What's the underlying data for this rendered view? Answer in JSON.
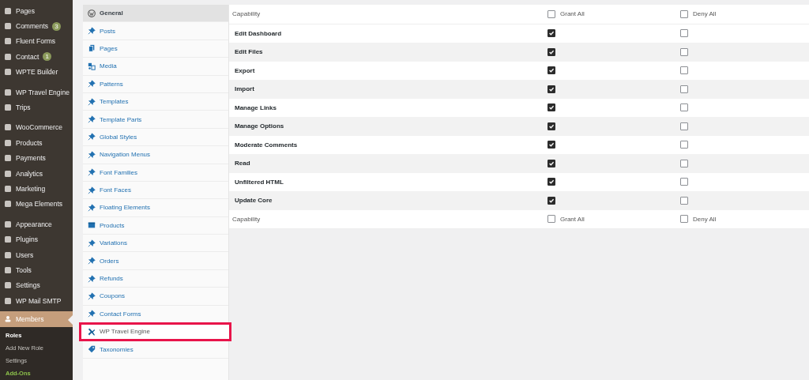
{
  "admin_menu": {
    "groups": [
      [
        {
          "label": "Pages"
        },
        {
          "label": "Comments",
          "badge": "3"
        },
        {
          "label": "Fluent Forms"
        },
        {
          "label": "Contact",
          "badge": "1"
        },
        {
          "label": "WPTE Builder"
        }
      ],
      [
        {
          "label": "WP Travel Engine"
        },
        {
          "label": "Trips"
        }
      ],
      [
        {
          "label": "WooCommerce"
        },
        {
          "label": "Products"
        },
        {
          "label": "Payments"
        },
        {
          "label": "Analytics"
        },
        {
          "label": "Marketing"
        },
        {
          "label": "Mega Elements"
        }
      ],
      [
        {
          "label": "Appearance"
        },
        {
          "label": "Plugins"
        },
        {
          "label": "Users"
        },
        {
          "label": "Tools"
        },
        {
          "label": "Settings"
        },
        {
          "label": "WP Mail SMTP"
        }
      ]
    ],
    "current": {
      "label": "Members"
    },
    "submenu": [
      {
        "label": "Roles",
        "selected": true
      },
      {
        "label": "Add New Role",
        "selected": false
      },
      {
        "label": "Settings",
        "selected": false
      },
      {
        "label": "Add-Ons",
        "selected": false,
        "color": "#8cc04b"
      }
    ]
  },
  "capability_tabs": [
    {
      "label": "General",
      "kind": "wordpress",
      "selected": true,
      "highlighted": false
    },
    {
      "label": "Posts",
      "kind": "pin",
      "selected": false,
      "highlighted": false
    },
    {
      "label": "Pages",
      "kind": "pages",
      "selected": false,
      "highlighted": false
    },
    {
      "label": "Media",
      "kind": "media",
      "selected": false,
      "highlighted": false
    },
    {
      "label": "Patterns",
      "kind": "pin",
      "selected": false,
      "highlighted": false
    },
    {
      "label": "Templates",
      "kind": "pin",
      "selected": false,
      "highlighted": false
    },
    {
      "label": "Template Parts",
      "kind": "pin",
      "selected": false,
      "highlighted": false
    },
    {
      "label": "Global Styles",
      "kind": "pin",
      "selected": false,
      "highlighted": false
    },
    {
      "label": "Navigation Menus",
      "kind": "pin",
      "selected": false,
      "highlighted": false
    },
    {
      "label": "Font Families",
      "kind": "pin",
      "selected": false,
      "highlighted": false
    },
    {
      "label": "Font Faces",
      "kind": "pin",
      "selected": false,
      "highlighted": false
    },
    {
      "label": "Floating Elements",
      "kind": "pin",
      "selected": false,
      "highlighted": false
    },
    {
      "label": "Products",
      "kind": "box",
      "selected": false,
      "highlighted": false
    },
    {
      "label": "Variations",
      "kind": "pin",
      "selected": false,
      "highlighted": false
    },
    {
      "label": "Orders",
      "kind": "pin",
      "selected": false,
      "highlighted": false
    },
    {
      "label": "Refunds",
      "kind": "pin",
      "selected": false,
      "highlighted": false
    },
    {
      "label": "Coupons",
      "kind": "pin",
      "selected": false,
      "highlighted": false
    },
    {
      "label": "Contact Forms",
      "kind": "pin",
      "selected": false,
      "highlighted": false
    },
    {
      "label": "WP Travel Engine",
      "kind": "plane",
      "selected": false,
      "highlighted": true
    },
    {
      "label": "Taxonomies",
      "kind": "tag",
      "selected": false,
      "highlighted": false
    }
  ],
  "table": {
    "header": {
      "column": "Capability",
      "grant_label": "Grant All",
      "grant_checked": false,
      "deny_label": "Deny All",
      "deny_checked": false
    },
    "rows": [
      {
        "capability": "Edit Dashboard",
        "grant": true,
        "deny": false
      },
      {
        "capability": "Edit Files",
        "grant": true,
        "deny": false
      },
      {
        "capability": "Export",
        "grant": true,
        "deny": false
      },
      {
        "capability": "Import",
        "grant": true,
        "deny": false
      },
      {
        "capability": "Manage Links",
        "grant": true,
        "deny": false
      },
      {
        "capability": "Manage Options",
        "grant": true,
        "deny": false
      },
      {
        "capability": "Moderate Comments",
        "grant": true,
        "deny": false
      },
      {
        "capability": "Read",
        "grant": true,
        "deny": false
      },
      {
        "capability": "Unfiltered HTML",
        "grant": true,
        "deny": false
      },
      {
        "capability": "Update Core",
        "grant": true,
        "deny": false
      }
    ],
    "footer": {
      "column": "Capability",
      "grant_label": "Grant All",
      "grant_checked": false,
      "deny_label": "Deny All",
      "deny_checked": false
    }
  }
}
